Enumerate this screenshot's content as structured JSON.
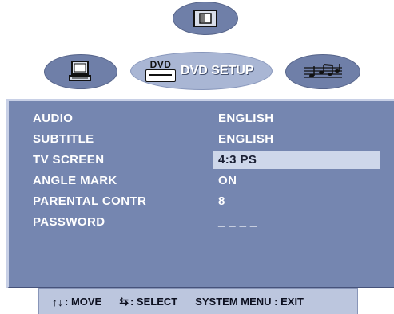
{
  "menu": {
    "tabs": [
      {
        "name": "system",
        "icon": "monitor-icon"
      },
      {
        "name": "dvd-setup",
        "label": "DVD SETUP",
        "logo_text": "DVD",
        "icon": "dvd-logo-icon",
        "active": true
      },
      {
        "name": "audio",
        "icon": "music-notes-icon"
      }
    ],
    "top_icon": "picture-icon"
  },
  "settings": [
    {
      "label": "AUDIO",
      "value": "ENGLISH"
    },
    {
      "label": "SUBTITLE",
      "value": "ENGLISH"
    },
    {
      "label": "TV SCREEN",
      "value": "4:3 PS",
      "selected": true
    },
    {
      "label": "ANGLE MARK",
      "value": "ON"
    },
    {
      "label": "PARENTAL CONTR",
      "value": "8"
    },
    {
      "label": "PASSWORD",
      "value": "_ _ _ _"
    }
  ],
  "footer": {
    "move": ": MOVE",
    "select": ": SELECT",
    "exit": "SYSTEM MENU : EXIT"
  },
  "colors": {
    "panel": "#7586b0",
    "highlight": "#ced7ea",
    "footer": "#bcc6de",
    "oval": "#6f7fa8",
    "oval_active": "#a9b6d4"
  }
}
